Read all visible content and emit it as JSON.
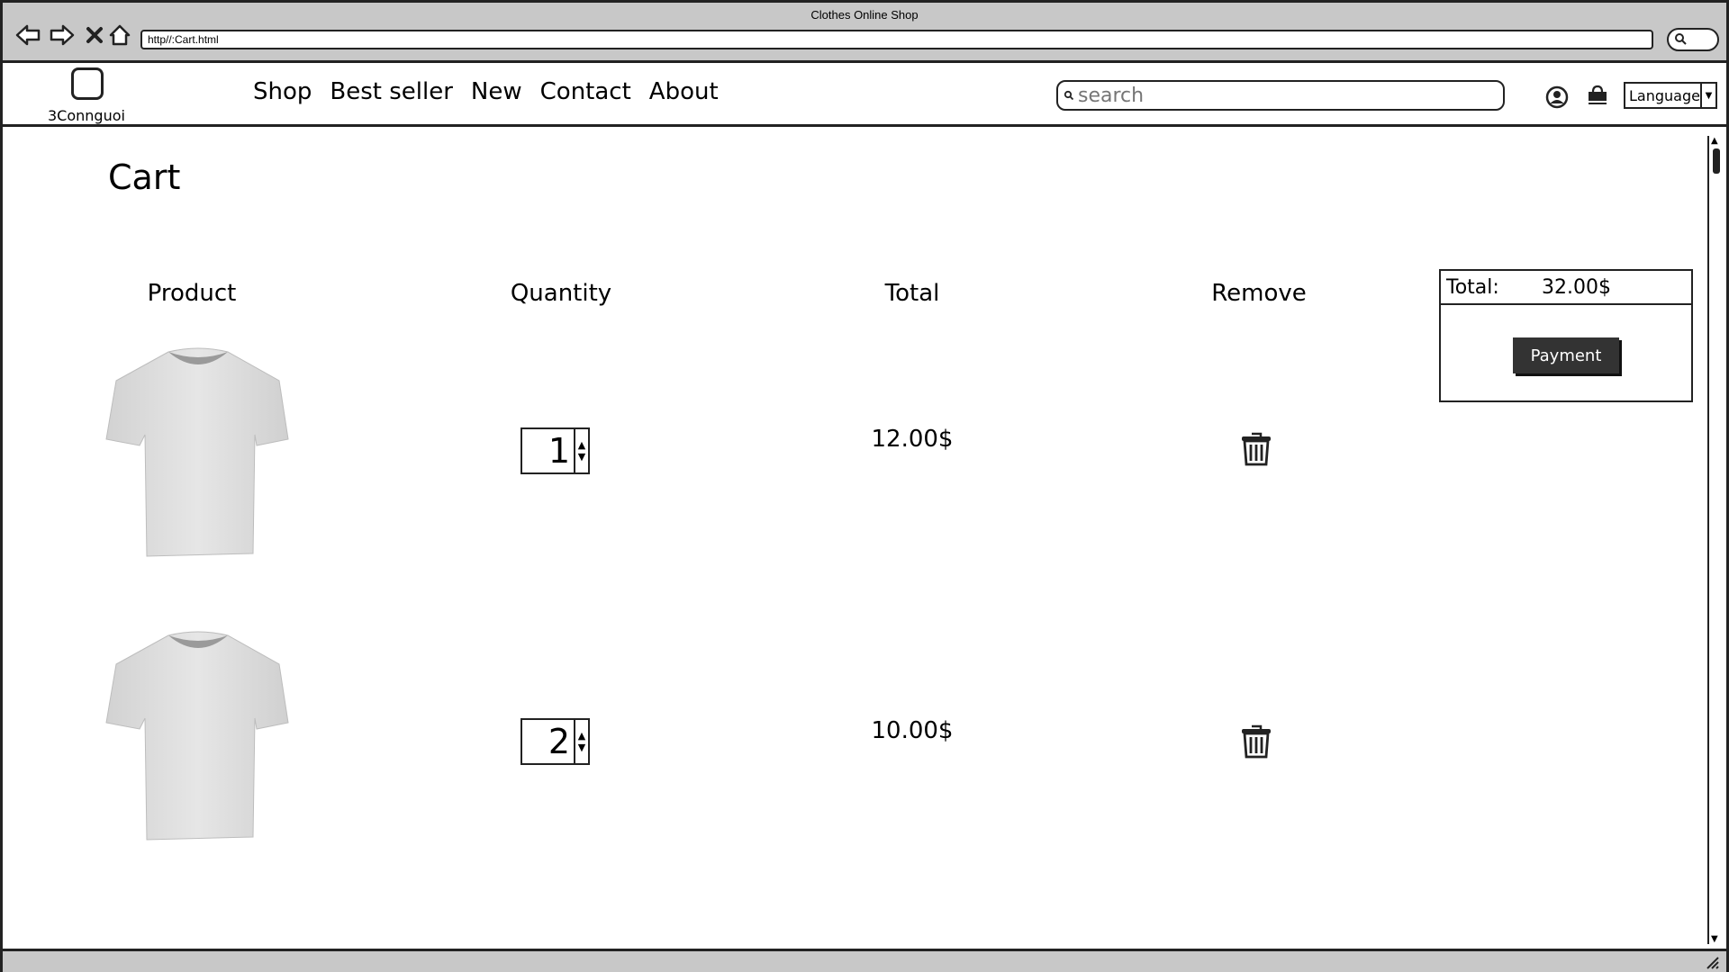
{
  "browser": {
    "title": "Clothes Online Shop",
    "url": "http//:Cart.html"
  },
  "header": {
    "logo_text": "3Connguoi",
    "nav": [
      "Shop",
      "Best seller",
      "New",
      "Contact",
      "About"
    ],
    "search_placeholder": "search",
    "language_label": "Language"
  },
  "page": {
    "title": "Cart",
    "columns": {
      "product": "Product",
      "quantity": "Quantity",
      "total": "Total",
      "remove": "Remove"
    }
  },
  "cart_items": [
    {
      "image": "t-shirt",
      "quantity": "1",
      "total": "12.00$"
    },
    {
      "image": "t-shirt",
      "quantity": "2",
      "total": "10.00$"
    }
  ],
  "summary": {
    "total_label": "Total:",
    "total_value": "32.00$",
    "payment_label": "Payment"
  }
}
